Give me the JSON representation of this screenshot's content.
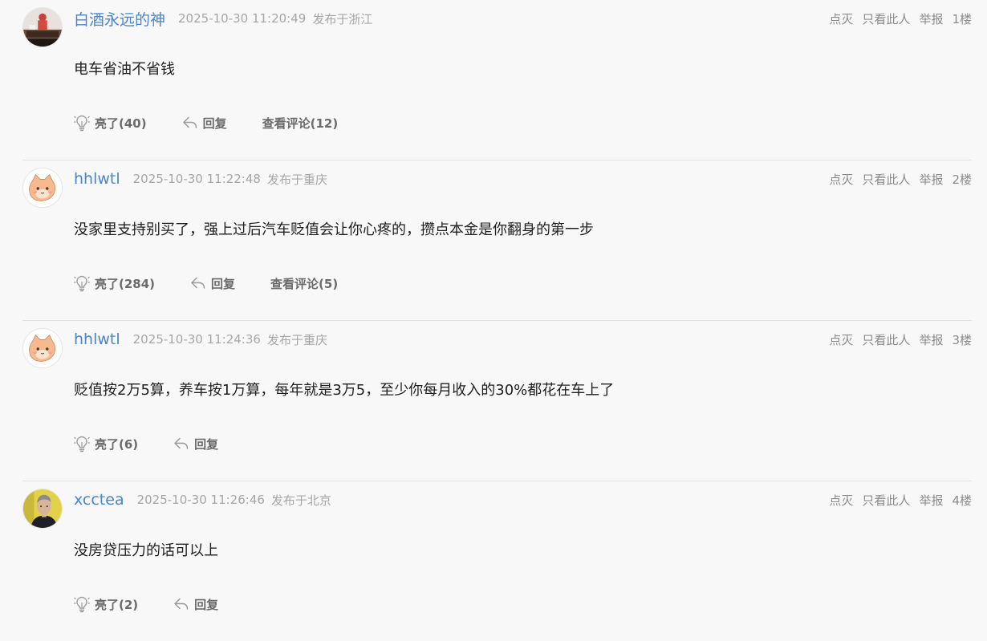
{
  "posts": [
    {
      "username": "白酒永远的神",
      "timestamp": "2025-10-30 11:20:49",
      "location": "发布于浙江",
      "content": "电车省油不省钱",
      "likes": "亮了(40)",
      "reply": "回复",
      "comments": "查看评论(12)",
      "dislike": "点灭",
      "only_this": "只看此人",
      "report": "举报",
      "floor": "1楼"
    },
    {
      "username": "hhlwtl",
      "timestamp": "2025-10-30 11:22:48",
      "location": "发布于重庆",
      "content": "没家里支持别买了，强上过后汽车贬值会让你心疼的，攒点本金是你翻身的第一步",
      "likes": "亮了(284)",
      "reply": "回复",
      "comments": "查看评论(5)",
      "dislike": "点灭",
      "only_this": "只看此人",
      "report": "举报",
      "floor": "2楼"
    },
    {
      "username": "hhlwtl",
      "timestamp": "2025-10-30 11:24:36",
      "location": "发布于重庆",
      "content": "贬值按2万5算，养车按1万算，每年就是3万5，至少你每月收入的30%都花在车上了",
      "likes": "亮了(6)",
      "reply": "回复",
      "dislike": "点灭",
      "only_this": "只看此人",
      "report": "举报",
      "floor": "3楼"
    },
    {
      "username": "xcctea",
      "timestamp": "2025-10-30 11:26:46",
      "location": "发布于北京",
      "content": "没房贷压力的话可以上",
      "likes": "亮了(2)",
      "reply": "回复",
      "dislike": "点灭",
      "only_this": "只看此人",
      "report": "举报",
      "floor": "4楼"
    }
  ]
}
